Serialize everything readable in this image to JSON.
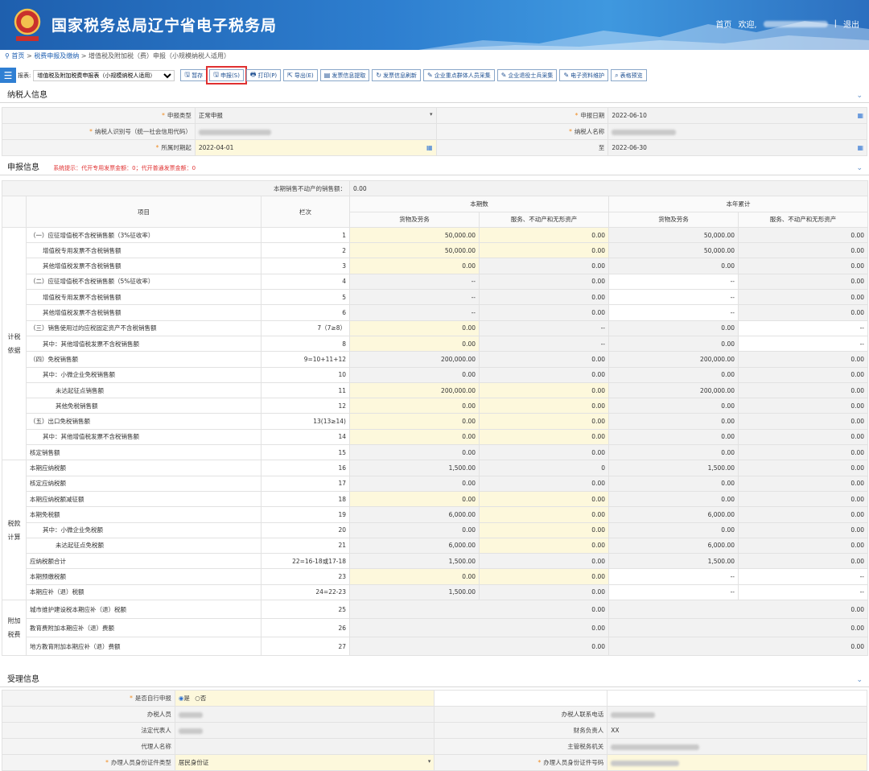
{
  "header": {
    "title": "国家税务总局辽宁省电子税务局",
    "home": "首页",
    "welcome": "欢迎,",
    "logout": "退出",
    "separator": "|"
  },
  "breadcrumb": {
    "home": "首页",
    "sep": ">",
    "level1": "税费申报及缴纳",
    "level2": "增值税及附加税（费）申报（小规模纳税人适用）"
  },
  "toolbar": {
    "select_label": "报表:",
    "select_value": "增值税及附加税费申报表（小规模纳税人适用）",
    "buttons": [
      {
        "label": "暂存",
        "icon": "save-icon",
        "glyph": "🖫"
      },
      {
        "label": "申报(S)",
        "icon": "declare-icon",
        "glyph": "🖫"
      },
      {
        "label": "打印(P)",
        "icon": "print-icon",
        "glyph": "🖶"
      },
      {
        "label": "导出(E)",
        "icon": "export-icon",
        "glyph": "⇱"
      },
      {
        "label": "发票信息提取",
        "icon": "invoice-icon",
        "glyph": "▤"
      },
      {
        "label": "发票信息刷新",
        "icon": "refresh-icon",
        "glyph": "↻"
      },
      {
        "label": "企业重点群体人员采集",
        "icon": "edit-icon",
        "glyph": "✎"
      },
      {
        "label": "企业退役士兵采集",
        "icon": "edit-icon",
        "glyph": "✎"
      },
      {
        "label": "电子资料维护",
        "icon": "edit-icon",
        "glyph": "✎"
      },
      {
        "label": "表格预览",
        "icon": "preview-icon",
        "glyph": "⌕"
      }
    ],
    "highlighted_index": 1
  },
  "taxpayer": {
    "section_title": "纳税人信息",
    "decl_type_label": "申报类型",
    "decl_type_value": "正常申报",
    "decl_date_label": "申报日期",
    "decl_date_value": "2022-06-10",
    "tax_id_label": "纳税人识别号（统一社会信用代码）",
    "name_label": "纳税人名称",
    "period_start_label": "所属时期起",
    "period_start_value": "2022-04-01",
    "period_end_label": "至",
    "period_end_value": "2022-06-30"
  },
  "declaration": {
    "section_title": "申报信息",
    "tip": "系统提示：代开专用发票金额：0；代开普通发票金额：0",
    "immovable_label": "本期销售不动产的销售额：",
    "immovable_value": "0.00",
    "headers": {
      "item": "项目",
      "col": "栏次",
      "current": "本期数",
      "ytd": "本年累计",
      "goods": "货物及劳务",
      "services": "服务、不动产和无形资产"
    },
    "groups": {
      "basis": "计税依据",
      "calc": "税款计算",
      "surcharge": "附加税费"
    },
    "rows": [
      {
        "item": "（一）应征增值税不含税销售额（3%征收率）",
        "col": "1",
        "indent": 0,
        "v": [
          "50,000.00",
          "0.00",
          "50,000.00",
          "0.00"
        ],
        "bg": [
          "e",
          "e",
          "v",
          "v"
        ]
      },
      {
        "item": "增值税专用发票不含税销售额",
        "col": "2",
        "indent": 1,
        "v": [
          "50,000.00",
          "0.00",
          "50,000.00",
          "0.00"
        ],
        "bg": [
          "e",
          "e",
          "v",
          "v"
        ]
      },
      {
        "item": "其他增值税发票不含税销售额",
        "col": "3",
        "indent": 1,
        "v": [
          "0.00",
          "0.00",
          "0.00",
          "0.00"
        ],
        "bg": [
          "e",
          "v",
          "v",
          "v"
        ]
      },
      {
        "item": "（二）应征增值税不含税销售额（5%征收率）",
        "col": "4",
        "indent": 0,
        "v": [
          "--",
          "0.00",
          "--",
          "0.00"
        ],
        "bg": [
          "v",
          "v",
          "w",
          "v"
        ]
      },
      {
        "item": "增值税专用发票不含税销售额",
        "col": "5",
        "indent": 1,
        "v": [
          "--",
          "0.00",
          "--",
          "0.00"
        ],
        "bg": [
          "v",
          "v",
          "w",
          "v"
        ]
      },
      {
        "item": "其他增值税发票不含税销售额",
        "col": "6",
        "indent": 1,
        "v": [
          "--",
          "0.00",
          "--",
          "0.00"
        ],
        "bg": [
          "v",
          "v",
          "w",
          "v"
        ]
      },
      {
        "item": "（三）销售使用过的应税固定资产不含税销售额",
        "col": "7（7≥8）",
        "indent": 0,
        "v": [
          "0.00",
          "--",
          "0.00",
          "--"
        ],
        "bg": [
          "e",
          "v",
          "v",
          "w"
        ]
      },
      {
        "item": "其中：其他增值税发票不含税销售额",
        "col": "8",
        "indent": 1,
        "v": [
          "0.00",
          "--",
          "0.00",
          "--"
        ],
        "bg": [
          "e",
          "v",
          "v",
          "w"
        ]
      },
      {
        "item": "（四）免税销售额",
        "col": "9=10+11+12",
        "indent": 0,
        "v": [
          "200,000.00",
          "0.00",
          "200,000.00",
          "0.00"
        ],
        "bg": [
          "v",
          "v",
          "v",
          "v"
        ]
      },
      {
        "item": "其中：小微企业免税销售额",
        "col": "10",
        "indent": 1,
        "v": [
          "0.00",
          "0.00",
          "0.00",
          "0.00"
        ],
        "bg": [
          "v",
          "v",
          "v",
          "v"
        ]
      },
      {
        "item": "未达起征点销售额",
        "col": "11",
        "indent": 2,
        "v": [
          "200,000.00",
          "0.00",
          "200,000.00",
          "0.00"
        ],
        "bg": [
          "e",
          "e",
          "v",
          "v"
        ]
      },
      {
        "item": "其他免税销售额",
        "col": "12",
        "indent": 2,
        "v": [
          "0.00",
          "0.00",
          "0.00",
          "0.00"
        ],
        "bg": [
          "e",
          "e",
          "v",
          "v"
        ]
      },
      {
        "item": "（五）出口免税销售额",
        "col": "13(13≥14)",
        "indent": 0,
        "v": [
          "0.00",
          "0.00",
          "0.00",
          "0.00"
        ],
        "bg": [
          "e",
          "e",
          "v",
          "v"
        ]
      },
      {
        "item": "其中：其他增值税发票不含税销售额",
        "col": "14",
        "indent": 1,
        "v": [
          "0.00",
          "0.00",
          "0.00",
          "0.00"
        ],
        "bg": [
          "e",
          "e",
          "v",
          "v"
        ]
      },
      {
        "item": "核定销售额",
        "col": "15",
        "indent": 0,
        "v": [
          "0.00",
          "0.00",
          "0.00",
          "0.00"
        ],
        "bg": [
          "v",
          "v",
          "v",
          "v"
        ]
      },
      {
        "item": "本期应纳税额",
        "col": "16",
        "indent": 0,
        "v": [
          "1,500.00",
          "0",
          "1,500.00",
          "0.00"
        ],
        "bg": [
          "v",
          "v",
          "v",
          "v"
        ]
      },
      {
        "item": "核定应纳税额",
        "col": "17",
        "indent": 0,
        "v": [
          "0.00",
          "0.00",
          "0.00",
          "0.00"
        ],
        "bg": [
          "v",
          "v",
          "v",
          "v"
        ]
      },
      {
        "item": "本期应纳税额减征额",
        "col": "18",
        "indent": 0,
        "v": [
          "0.00",
          "0.00",
          "0.00",
          "0.00"
        ],
        "bg": [
          "e",
          "e",
          "v",
          "v"
        ]
      },
      {
        "item": "本期免税额",
        "col": "19",
        "indent": 0,
        "v": [
          "6,000.00",
          "0.00",
          "6,000.00",
          "0.00"
        ],
        "bg": [
          "v",
          "e",
          "v",
          "v"
        ]
      },
      {
        "item": "其中：小微企业免税额",
        "col": "20",
        "indent": 1,
        "v": [
          "0.00",
          "0.00",
          "0.00",
          "0.00"
        ],
        "bg": [
          "v",
          "e",
          "v",
          "v"
        ]
      },
      {
        "item": "未达起征点免税额",
        "col": "21",
        "indent": 2,
        "v": [
          "6,000.00",
          "0.00",
          "6,000.00",
          "0.00"
        ],
        "bg": [
          "v",
          "e",
          "v",
          "v"
        ]
      },
      {
        "item": "应纳税额合计",
        "col": "22=16-18或17-18",
        "indent": 0,
        "v": [
          "1,500.00",
          "0.00",
          "1,500.00",
          "0.00"
        ],
        "bg": [
          "v",
          "v",
          "v",
          "v"
        ]
      },
      {
        "item": "本期预缴税额",
        "col": "23",
        "indent": 0,
        "v": [
          "0.00",
          "0.00",
          "--",
          "--"
        ],
        "bg": [
          "e",
          "e",
          "w",
          "w"
        ]
      },
      {
        "item": "本期应补（退）税额",
        "col": "24=22-23",
        "indent": 0,
        "v": [
          "1,500.00",
          "0.00",
          "--",
          "--"
        ],
        "bg": [
          "v",
          "v",
          "w",
          "w"
        ]
      }
    ],
    "surcharge_rows": [
      {
        "item": "城市维护建设税本期应补（退）税额",
        "col": "25",
        "v": [
          "0.00",
          "0.00"
        ]
      },
      {
        "item": "教育费附加本期应补（退）费额",
        "col": "26",
        "v": [
          "0.00",
          "0.00"
        ]
      },
      {
        "item": "地方教育附加本期应补（退）费额",
        "col": "27",
        "v": [
          "0.00",
          "0.00"
        ]
      }
    ]
  },
  "acceptance": {
    "section_title": "受理信息",
    "self_label": "是否自行申报",
    "yes": "是",
    "no": "否",
    "handler_label": "办税人员",
    "handler_phone_label": "办税人联系电话",
    "legal_label": "法定代表人",
    "finance_label": "财务负责人",
    "finance_value": "XX",
    "agent_label": "代理人名称",
    "authority_label": "主管税务机关",
    "id_type_label": "办理人员身份证件类型",
    "id_type_value": "居民身份证",
    "id_no_label": "办理人员身份证件号码"
  },
  "colors": {
    "banner": "#2e7fd0",
    "highlight": "#e03030",
    "editable": "#fdf8dc",
    "readonly": "#f2f2f2"
  }
}
